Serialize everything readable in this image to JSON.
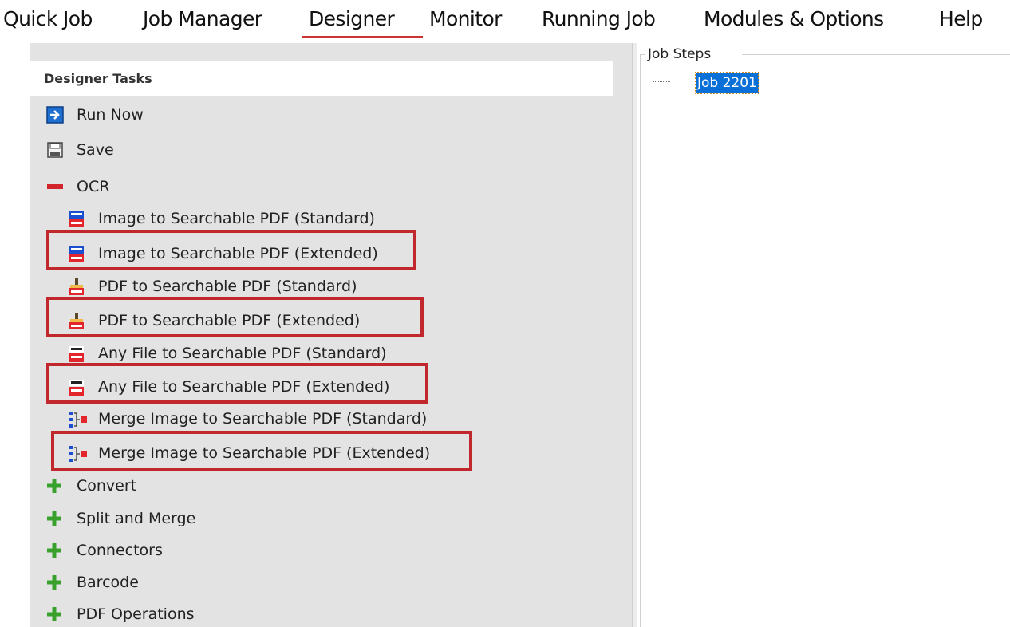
{
  "menu": {
    "items": [
      {
        "label": "Quick Job"
      },
      {
        "label": "Job Manager"
      },
      {
        "label": "Designer",
        "active": true
      },
      {
        "label": "Monitor"
      },
      {
        "label": "Running Job"
      },
      {
        "label": "Modules & Options"
      },
      {
        "label": "Help"
      }
    ],
    "active_color": "#cc3333"
  },
  "designer_tasks": {
    "header": "Designer Tasks",
    "run_now": {
      "label": "Run Now",
      "icon": "arrow-right-icon"
    },
    "save": {
      "label": "Save",
      "icon": "floppy-disk-icon"
    },
    "ocr": {
      "label": "OCR",
      "expanded": true,
      "icon": "minus-icon",
      "items": [
        {
          "label": "Image to Searchable PDF (Standard)",
          "icon": "tiff-pdf-icon",
          "highlighted": false
        },
        {
          "label": "Image to Searchable PDF (Extended)",
          "icon": "tiff-pdf-icon",
          "highlighted": true
        },
        {
          "label": "PDF to Searchable PDF (Standard)",
          "icon": "pdf-scan-icon",
          "highlighted": false
        },
        {
          "label": "PDF to Searchable PDF (Extended)",
          "icon": "pdf-scan-icon",
          "highlighted": true
        },
        {
          "label": "Any File to Searchable PDF (Standard)",
          "icon": "any-pdf-icon",
          "highlighted": false
        },
        {
          "label": "Any File to Searchable PDF (Extended)",
          "icon": "any-pdf-icon",
          "highlighted": true
        },
        {
          "label": "Merge Image to Searchable PDF (Standard)",
          "icon": "merge-icon",
          "highlighted": false
        },
        {
          "label": "Merge Image to Searchable PDF (Extended)",
          "icon": "merge-icon",
          "highlighted": true
        }
      ]
    },
    "groups": [
      {
        "label": "Convert",
        "icon": "plus-icon"
      },
      {
        "label": "Split and Merge",
        "icon": "plus-icon"
      },
      {
        "label": "Connectors",
        "icon": "plus-icon"
      },
      {
        "label": "Barcode",
        "icon": "plus-icon"
      },
      {
        "label": "PDF Operations",
        "icon": "plus-icon"
      }
    ],
    "highlight_color": "#c0282d"
  },
  "job_steps": {
    "title": "Job Steps",
    "nodes": [
      {
        "label": "Job 2201",
        "selected": true
      }
    ],
    "selection_color": "#0a6fd6"
  }
}
